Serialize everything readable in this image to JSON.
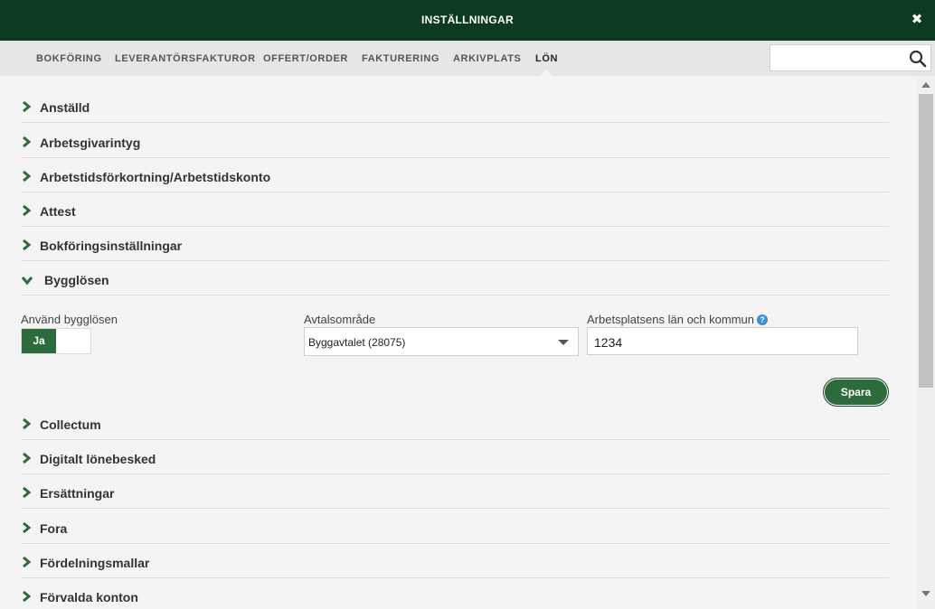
{
  "window": {
    "title": "INSTÄLLNINGAR",
    "close_icon": "close-icon"
  },
  "tabs": [
    {
      "label": "BOKFÖRING"
    },
    {
      "label": "LEVERANTÖRSFAKTUROR"
    },
    {
      "label": "OFFERT/ORDER"
    },
    {
      "label": "FAKTURERING"
    },
    {
      "label": "ARKIVPLATS"
    },
    {
      "label": "LÖN",
      "active": true
    }
  ],
  "search": {
    "value": "",
    "placeholder": "",
    "icon": "search-icon"
  },
  "sections": [
    {
      "label": "Anställd",
      "expanded": false
    },
    {
      "label": "Arbetsgivarintyg",
      "expanded": false
    },
    {
      "label": "Arbetstidsförkortning/Arbetstidskonto",
      "expanded": false
    },
    {
      "label": "Attest",
      "expanded": false
    },
    {
      "label": "Bokföringsinställningar",
      "expanded": false
    },
    {
      "label": "Bygglösen",
      "expanded": true
    },
    {
      "label": "Collectum",
      "expanded": false
    },
    {
      "label": "Digitalt lönebesked",
      "expanded": false
    },
    {
      "label": "Ersättningar",
      "expanded": false
    },
    {
      "label": "Fora",
      "expanded": false
    },
    {
      "label": "Fördelningsmallar",
      "expanded": false
    },
    {
      "label": "Förvalda konton",
      "expanded": false
    }
  ],
  "bygglosen": {
    "use_label": "Använd bygglösen",
    "toggle_on_label": "Ja",
    "avtal_label": "Avtalsområde",
    "avtal_value": "Byggavtalet (28075)",
    "lan_label": "Arbetsplatsens län och kommun",
    "lan_value": "1234",
    "help_glyph": "?",
    "save_label": "Spara"
  },
  "colors": {
    "header_bg": "#0c3b22",
    "accent_green": "#2d6b3c",
    "help_blue": "#3a8fd6"
  }
}
